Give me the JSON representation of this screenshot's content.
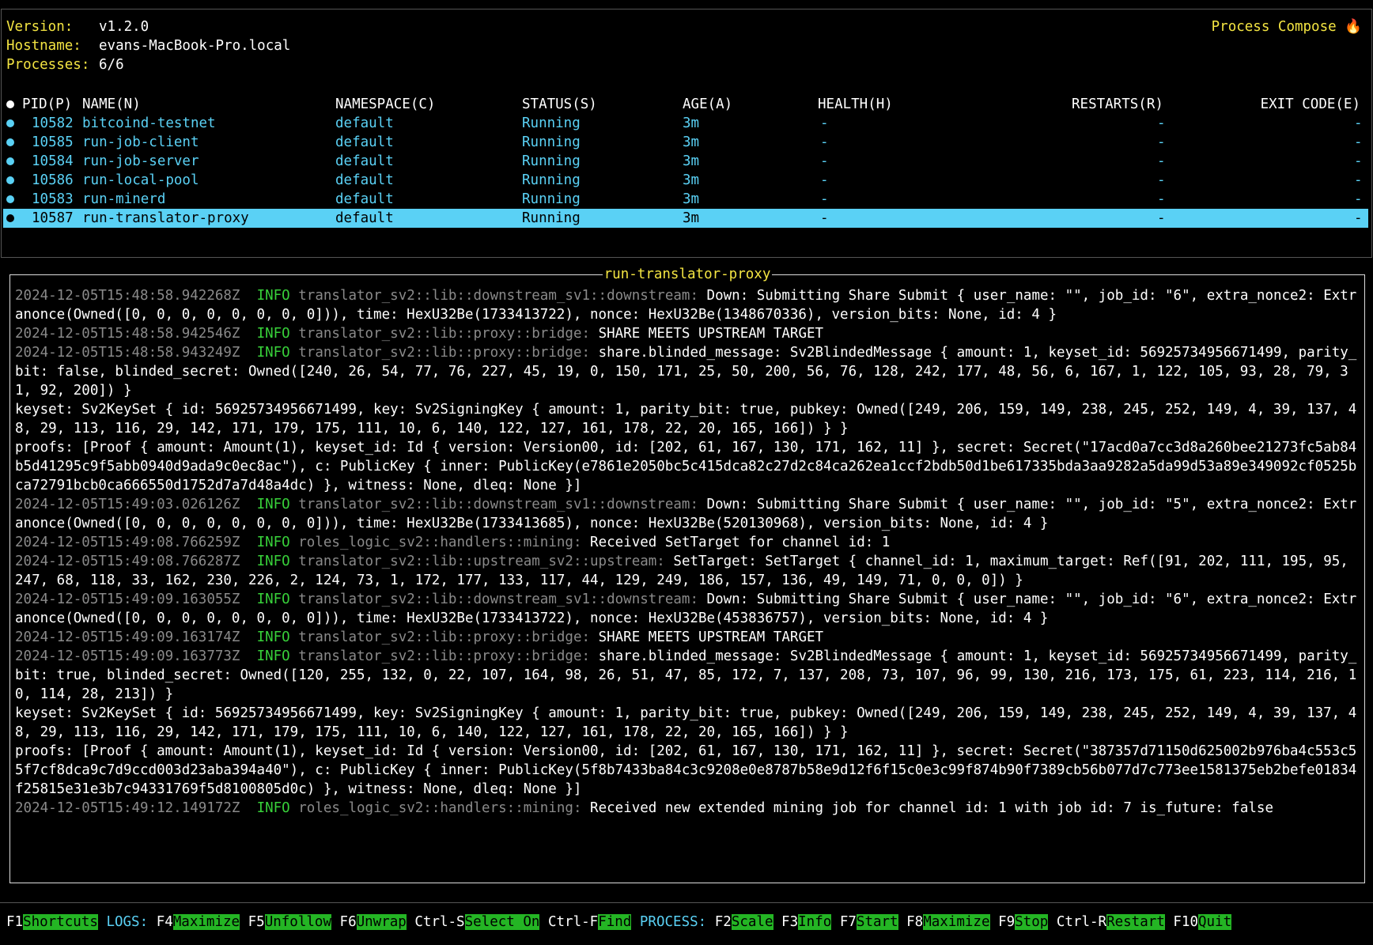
{
  "header": {
    "version_label": "Version:",
    "version_value": "v1.2.0",
    "hostname_label": "Hostname:",
    "hostname_value": "evans-MacBook-Pro.local",
    "processes_label": "Processes:",
    "processes_value": "6/6",
    "app_name": "Process Compose 🔥"
  },
  "table": {
    "columns": [
      "PID(P)",
      "NAME(N)",
      "NAMESPACE(C)",
      "STATUS(S)",
      "AGE(A)",
      "HEALTH(H)",
      "RESTARTS(R)",
      "EXIT CODE(E)"
    ],
    "rows": [
      {
        "pid": "10582",
        "name": "bitcoind-testnet",
        "namespace": "default",
        "status": "Running",
        "age": "3m",
        "health": "-",
        "restarts": "-",
        "exit": "-"
      },
      {
        "pid": "10585",
        "name": "run-job-client",
        "namespace": "default",
        "status": "Running",
        "age": "3m",
        "health": "-",
        "restarts": "-",
        "exit": "-"
      },
      {
        "pid": "10584",
        "name": "run-job-server",
        "namespace": "default",
        "status": "Running",
        "age": "3m",
        "health": "-",
        "restarts": "-",
        "exit": "-"
      },
      {
        "pid": "10586",
        "name": "run-local-pool",
        "namespace": "default",
        "status": "Running",
        "age": "3m",
        "health": "-",
        "restarts": "-",
        "exit": "-"
      },
      {
        "pid": "10583",
        "name": "run-minerd",
        "namespace": "default",
        "status": "Running",
        "age": "3m",
        "health": "-",
        "restarts": "-",
        "exit": "-"
      },
      {
        "pid": "10587",
        "name": "run-translator-proxy",
        "namespace": "default",
        "status": "Running",
        "age": "3m",
        "health": "-",
        "restarts": "-",
        "exit": "-",
        "selected": true
      }
    ]
  },
  "log_panel": {
    "title": "run-translator-proxy",
    "entries": [
      {
        "ts": "2024-12-05T15:48:58.942268Z",
        "level": "INFO",
        "target": "translator_sv2::lib::downstream_sv1::downstream:",
        "msg": "Down: Submitting Share Submit { user_name: \"\", job_id: \"6\", extra_nonce2: Extranonce(Owned([0, 0, 0, 0, 0, 0, 0, 0])), time: HexU32Be(1733413722), nonce: HexU32Be(1348670336), version_bits: None, id: 4 }"
      },
      {
        "ts": "2024-12-05T15:48:58.942546Z",
        "level": "INFO",
        "target": "translator_sv2::lib::proxy::bridge:",
        "msg": "SHARE MEETS UPSTREAM TARGET"
      },
      {
        "ts": "2024-12-05T15:48:58.943249Z",
        "level": "INFO",
        "target": "translator_sv2::lib::proxy::bridge:",
        "msg": "share.blinded_message: Sv2BlindedMessage { amount: 1, keyset_id: 56925734956671499, parity_bit: false, blinded_secret: Owned([240, 26, 54, 77, 76, 227, 45, 19, 0, 150, 171, 25, 50, 200, 56, 76, 128, 242, 177, 48, 56, 6, 167, 1, 122, 105, 93, 28, 79, 31, 92, 200]) }"
      },
      {
        "ts": "",
        "level": "",
        "target": "",
        "msg": "keyset: Sv2KeySet { id: 56925734956671499, key: Sv2SigningKey { amount: 1, parity_bit: true, pubkey: Owned([249, 206, 159, 149, 238, 245, 252, 149, 4, 39, 137, 48, 29, 113, 116, 29, 142, 171, 179, 175, 111, 10, 6, 140, 122, 127, 161, 178, 22, 20, 165, 166]) } }"
      },
      {
        "ts": "",
        "level": "",
        "target": "",
        "msg": "proofs: [Proof { amount: Amount(1), keyset_id: Id { version: Version00, id: [202, 61, 167, 130, 171, 162, 11] }, secret: Secret(\"17acd0a7cc3d8a260bee21273fc5ab84b5d41295c9f5abb0940d9ada9c0ec8ac\"), c: PublicKey { inner: PublicKey(e7861e2050bc5c415dca82c27d2c84ca262ea1ccf2bdb50d1be617335bda3aa9282a5da99d53a89e349092cf0525bca72791bcb0ca666550d1752d7a7d48a4dc) }, witness: None, dleq: None }]"
      },
      {
        "ts": "2024-12-05T15:49:03.026126Z",
        "level": "INFO",
        "target": "translator_sv2::lib::downstream_sv1::downstream:",
        "msg": "Down: Submitting Share Submit { user_name: \"\", job_id: \"5\", extra_nonce2: Extranonce(Owned([0, 0, 0, 0, 0, 0, 0, 0])), time: HexU32Be(1733413685), nonce: HexU32Be(520130968), version_bits: None, id: 4 }"
      },
      {
        "ts": "2024-12-05T15:49:08.766259Z",
        "level": "INFO",
        "target": "roles_logic_sv2::handlers::mining:",
        "msg": "Received SetTarget for channel id: 1"
      },
      {
        "ts": "2024-12-05T15:49:08.766287Z",
        "level": "INFO",
        "target": "translator_sv2::lib::upstream_sv2::upstream:",
        "msg": "SetTarget: SetTarget { channel_id: 1, maximum_target: Ref([91, 202, 111, 195, 95, 247, 68, 118, 33, 162, 230, 226, 2, 124, 73, 1, 172, 177, 133, 117, 44, 129, 249, 186, 157, 136, 49, 149, 71, 0, 0, 0]) }"
      },
      {
        "ts": "2024-12-05T15:49:09.163055Z",
        "level": "INFO",
        "target": "translator_sv2::lib::downstream_sv1::downstream:",
        "msg": "Down: Submitting Share Submit { user_name: \"\", job_id: \"6\", extra_nonce2: Extranonce(Owned([0, 0, 0, 0, 0, 0, 0, 0])), time: HexU32Be(1733413722), nonce: HexU32Be(453836757), version_bits: None, id: 4 }"
      },
      {
        "ts": "2024-12-05T15:49:09.163174Z",
        "level": "INFO",
        "target": "translator_sv2::lib::proxy::bridge:",
        "msg": "SHARE MEETS UPSTREAM TARGET"
      },
      {
        "ts": "2024-12-05T15:49:09.163773Z",
        "level": "INFO",
        "target": "translator_sv2::lib::proxy::bridge:",
        "msg": "share.blinded_message: Sv2BlindedMessage { amount: 1, keyset_id: 56925734956671499, parity_bit: true, blinded_secret: Owned([120, 255, 132, 0, 22, 107, 164, 98, 26, 51, 47, 85, 172, 7, 137, 208, 73, 107, 96, 99, 130, 216, 173, 175, 61, 223, 114, 216, 10, 114, 28, 213]) }"
      },
      {
        "ts": "",
        "level": "",
        "target": "",
        "msg": "keyset: Sv2KeySet { id: 56925734956671499, key: Sv2SigningKey { amount: 1, parity_bit: true, pubkey: Owned([249, 206, 159, 149, 238, 245, 252, 149, 4, 39, 137, 48, 29, 113, 116, 29, 142, 171, 179, 175, 111, 10, 6, 140, 122, 127, 161, 178, 22, 20, 165, 166]) } }"
      },
      {
        "ts": "",
        "level": "",
        "target": "",
        "msg": "proofs: [Proof { amount: Amount(1), keyset_id: Id { version: Version00, id: [202, 61, 167, 130, 171, 162, 11] }, secret: Secret(\"387357d71150d625002b976ba4c553c55f7cf8dca9c7d9ccd003d23aba394a40\"), c: PublicKey { inner: PublicKey(5f8b7433ba84c3c9208e0e8787b58e9d12f6f15c0e3c99f874b90f7389cb56b077d7c773ee1581375eb2befe01834f25815e31e3b7c94331769f5d8100805d0c) }, witness: None, dleq: None }]"
      },
      {
        "ts": "2024-12-05T15:49:12.149172Z",
        "level": "INFO",
        "target": "roles_logic_sv2::handlers::mining:",
        "msg": "Received new extended mining job for channel id: 1 with job id: 7 is_future: false"
      }
    ]
  },
  "footer": {
    "items": [
      {
        "key": "F1",
        "label": "Shortcuts"
      },
      {
        "section": "LOGS:"
      },
      {
        "key": "F4",
        "label": "Maximize"
      },
      {
        "key": "F5",
        "label": "Unfollow"
      },
      {
        "key": "F6",
        "label": "Unwrap"
      },
      {
        "key": "Ctrl-S",
        "label": "Select On"
      },
      {
        "key": "Ctrl-F",
        "label": "Find"
      },
      {
        "section": "PROCESS:"
      },
      {
        "key": "F2",
        "label": "Scale"
      },
      {
        "key": "F3",
        "label": "Info"
      },
      {
        "key": "F7",
        "label": "Start"
      },
      {
        "key": "F8",
        "label": "Maximize"
      },
      {
        "key": "F9",
        "label": "Stop"
      },
      {
        "key": "Ctrl-R",
        "label": "Restart"
      },
      {
        "key": "F10",
        "label": "Quit"
      }
    ]
  },
  "colors": {
    "accent_yellow": "#f4e542",
    "accent_cyan": "#5ad1f5",
    "info_green": "#38d13a",
    "footer_green": "#24b524",
    "muted_gray": "#8a8a8a"
  }
}
